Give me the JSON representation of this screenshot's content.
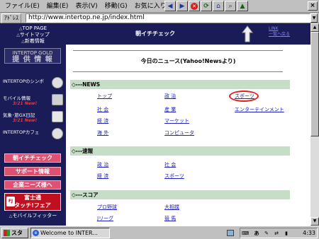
{
  "menu": {
    "items": [
      "ファイル(E)",
      "編集(E)",
      "表示(V)",
      "移動(G)",
      "お気に入り(A)"
    ]
  },
  "toolbar": {
    "close_label": "×"
  },
  "address": {
    "label": "ｱﾄﾞﾚｽ",
    "url": "http://www.intertop.ne.jp/index.html"
  },
  "sidebar": {
    "top_links": [
      "TOP PAGE",
      "サイトマップ",
      "新着情報"
    ],
    "info_button": {
      "top": "INTERTOP GOLD",
      "big": "提 供 情 報"
    },
    "icon_items": [
      {
        "label": "INTERTOPのシンボ",
        "new": ""
      },
      {
        "label": "モバイル情報",
        "new": "3/21 New!"
      },
      {
        "label": "気象･旅GX日記",
        "new": "3/21 New!"
      },
      {
        "label": "INTERTOPカフェ",
        "new": ""
      }
    ],
    "pink_buttons": [
      "朝イチチェック",
      "サポート情報",
      "企業ニーズ様へ"
    ],
    "fujitsu": {
      "line1": "富士通",
      "line2": "タッチ!フェア",
      "logo": "FJ"
    },
    "bottom_link": "モバイルフィッター"
  },
  "content": {
    "header_title": "朝イチチェック",
    "up_links": [
      "LINK",
      "一覧へ戻る"
    ],
    "news_title": "今日のニュース(Yahoo!Newsより)",
    "sections": [
      {
        "title": "◇---NEWS",
        "links": [
          "トップ",
          "政 治",
          "スポーツ",
          "社 会",
          "産 業",
          "エンターテインメント",
          "経 済",
          "マーケット",
          "海 外",
          "コンピュータ"
        ]
      },
      {
        "title": "◇---速報",
        "links": [
          "政 治",
          "社 会",
          "経 済",
          "スポーツ"
        ]
      },
      {
        "title": "◇---スコア",
        "links": [
          "プロ野球",
          "大相撲",
          "Jリーグ",
          "競 馬"
        ]
      }
    ]
  },
  "scrollbar": {
    "up": "▲",
    "down": "▼"
  },
  "taskbar": {
    "start": "スタート",
    "task": "Welcome to INTER...",
    "ime": "あ",
    "clock": "4:33"
  }
}
